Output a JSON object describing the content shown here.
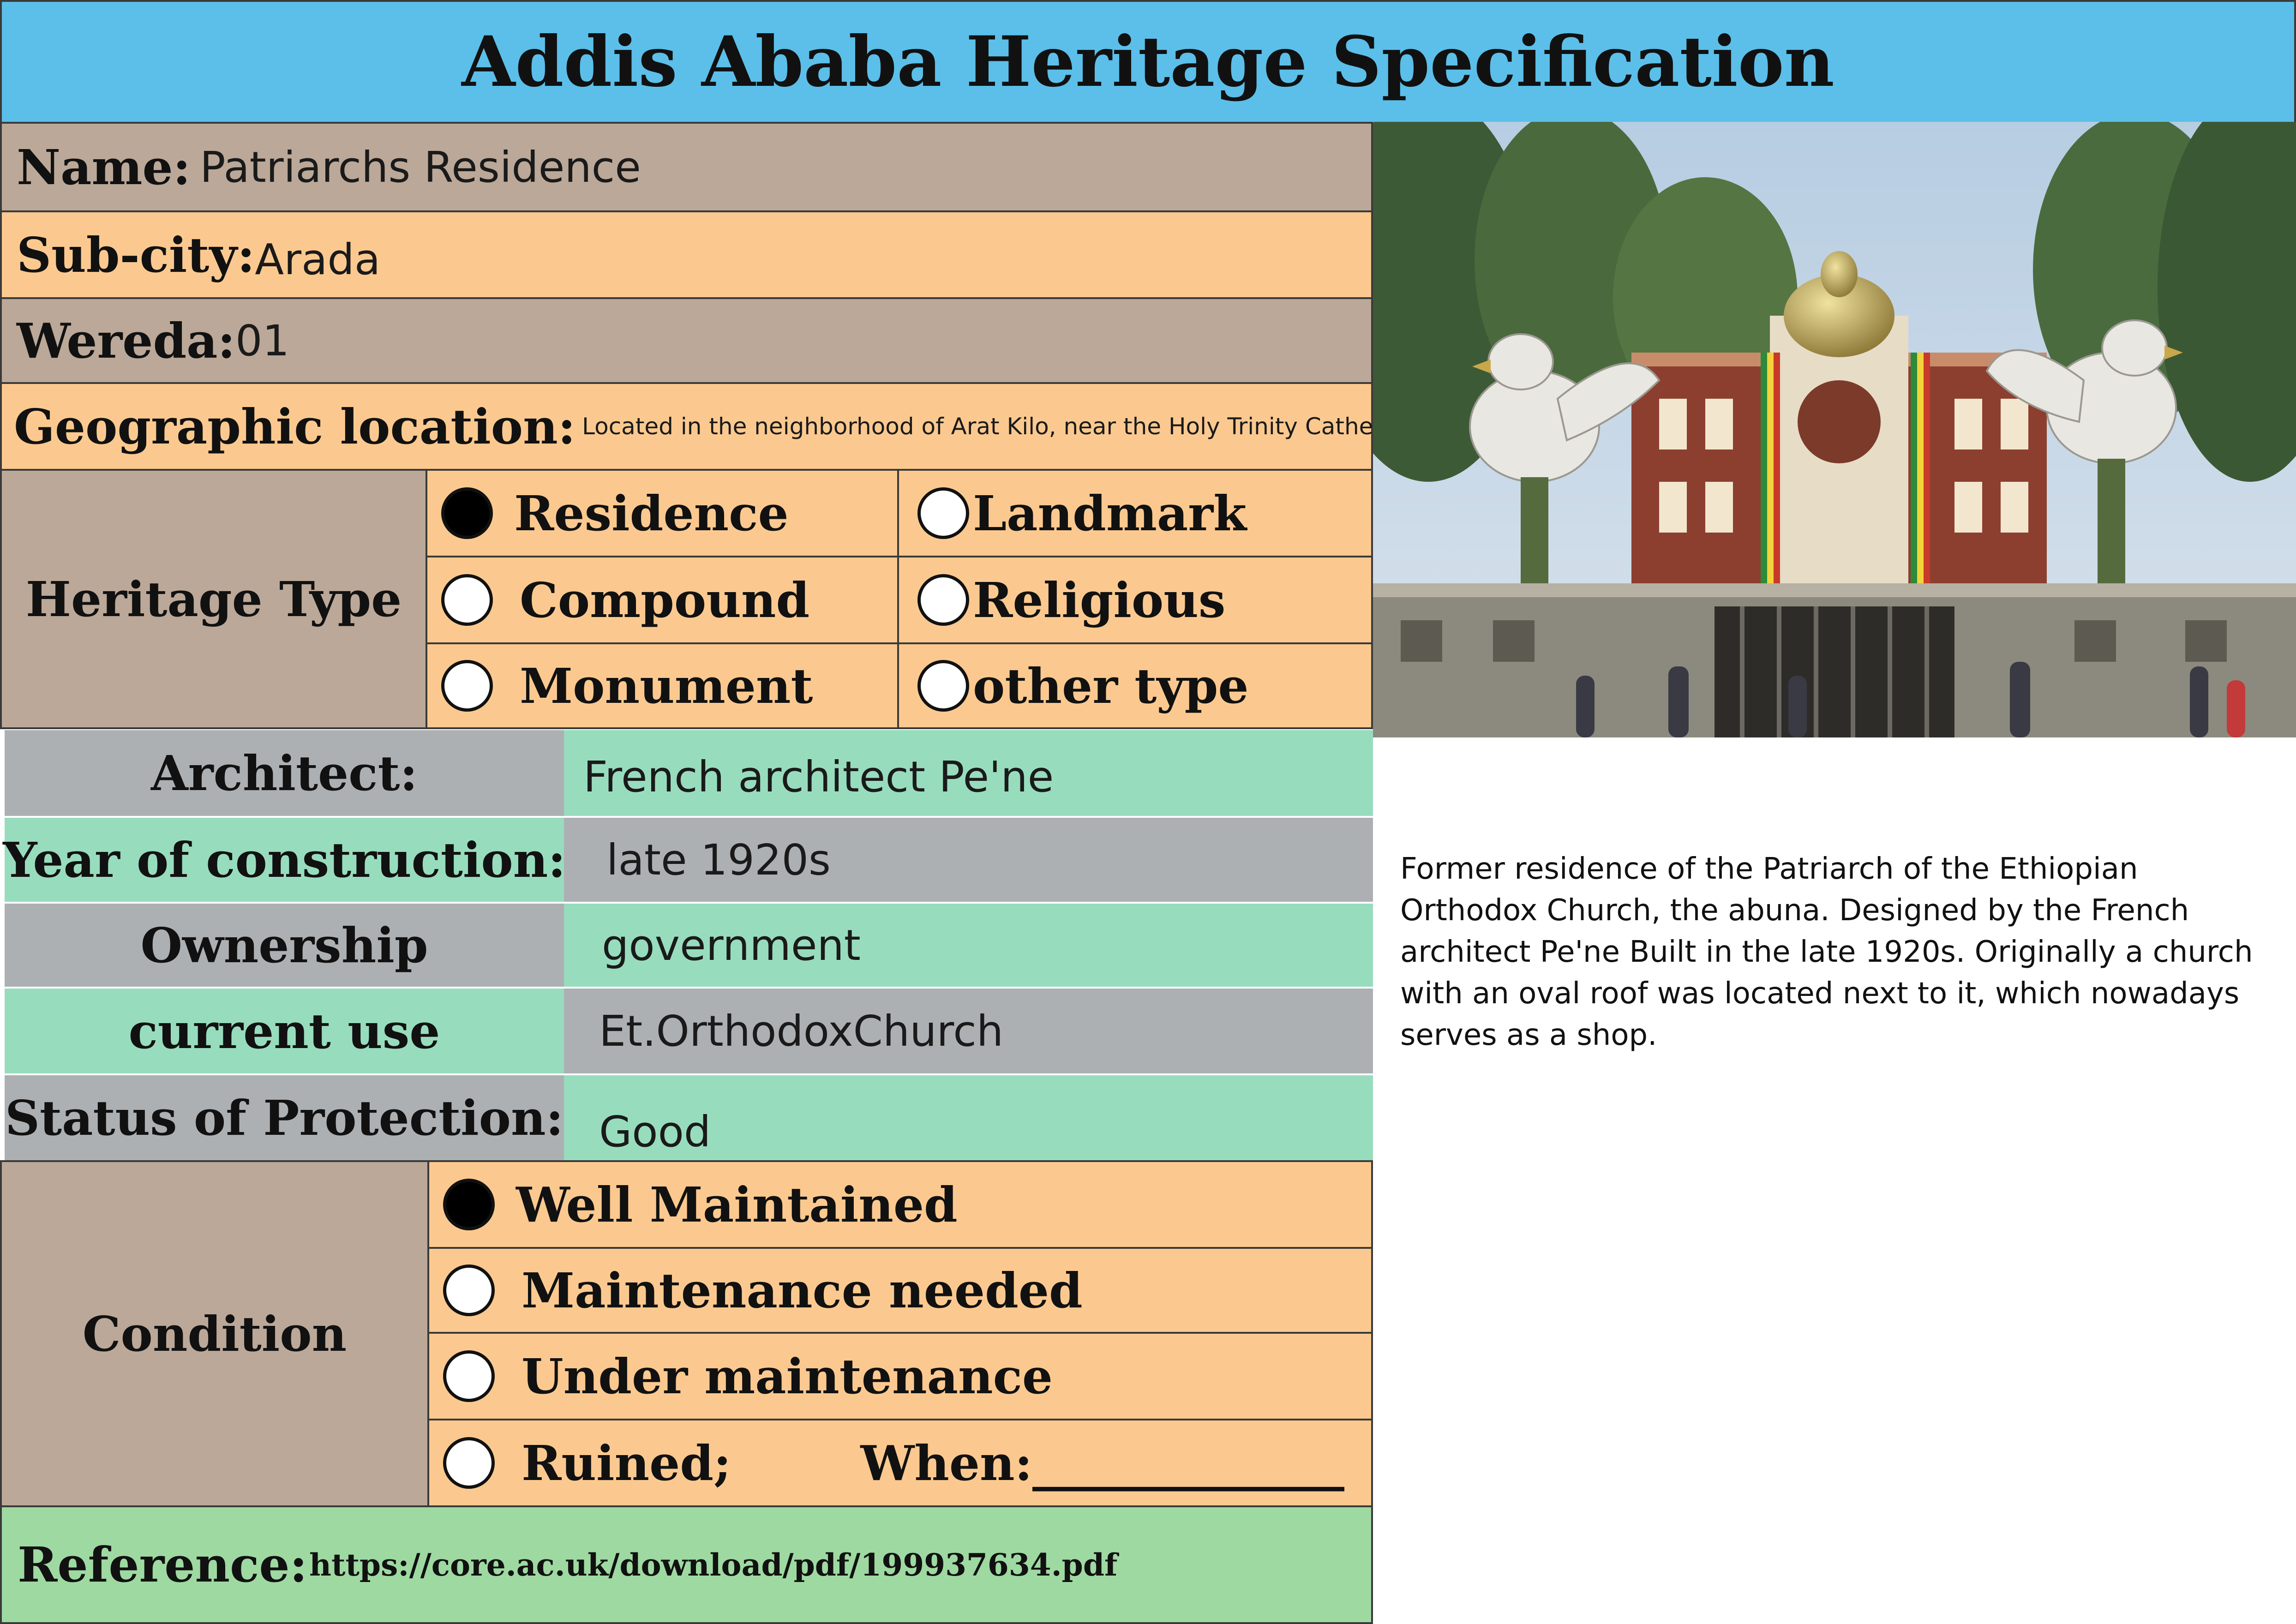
{
  "title": "Addis Ababa Heritage Specification",
  "name": {
    "label": "Name:",
    "value": "Patriarchs Residence"
  },
  "subcity": {
    "label": "Sub-city:",
    "value": "Arada"
  },
  "wereda": {
    "label": "Wereda:",
    "value": "01"
  },
  "geo": {
    "label": "Geographic location:",
    "value": "Located in the neighborhood of Arat Kilo, near the Holy Trinity Cathedral"
  },
  "heritage_type": {
    "label": "Heritage Type",
    "options": [
      {
        "label": "Residence",
        "selected": true
      },
      {
        "label": "Landmark",
        "selected": false
      },
      {
        "label": "Compound",
        "selected": false
      },
      {
        "label": "Religious",
        "selected": false
      },
      {
        "label": "Monument",
        "selected": false
      },
      {
        "label": "other type",
        "selected": false
      }
    ]
  },
  "architect": {
    "label": "Architect:",
    "value": "French architect Pe'ne"
  },
  "year": {
    "label": "Year of construction:",
    "value": "late 1920s"
  },
  "ownership": {
    "label": "Ownership",
    "value": "government"
  },
  "current_use": {
    "label": "current use",
    "value": "Et.OrthodoxChurch"
  },
  "protection": {
    "label": "Status of Protection:",
    "value": "Good"
  },
  "condition": {
    "label": "Condition",
    "options": [
      {
        "label": "Well Maintained",
        "selected": true
      },
      {
        "label": "Maintenance needed",
        "selected": false
      },
      {
        "label": "Under maintenance",
        "selected": false
      },
      {
        "label": "Ruined;",
        "selected": false
      }
    ],
    "when_label": "When:",
    "when_blank": "_____________"
  },
  "reference": {
    "label": "Reference:",
    "value": "https://core.ac.uk/download/pdf/199937634.pdf"
  },
  "description": "Former residence of the Patriarch of the Ethiopian Orthodox Church, the abuna. Designed by the French architect Pe'ne Built in the late 1920s. Originally a church with an oval roof was located next to it, which nowadays serves as a shop."
}
